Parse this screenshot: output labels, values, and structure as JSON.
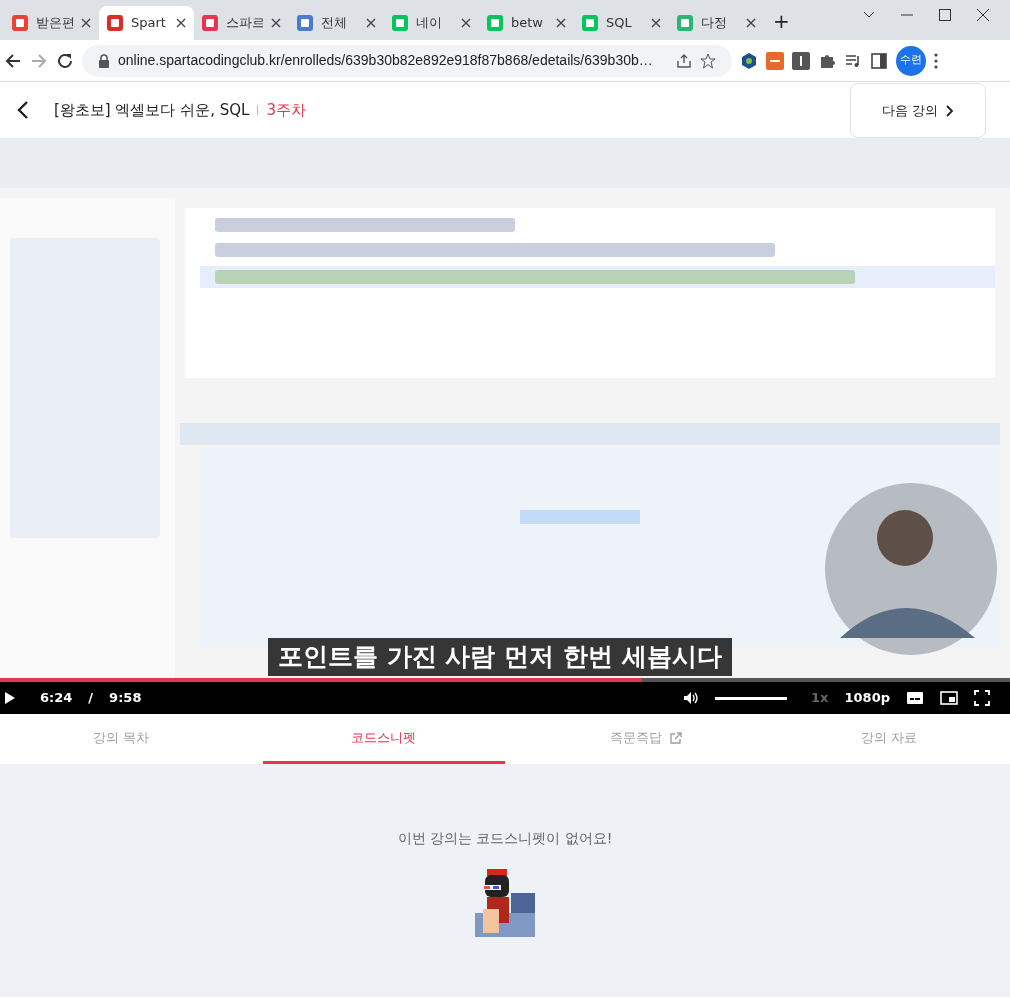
{
  "browser": {
    "tabs": [
      {
        "label": "받은편",
        "selected": false
      },
      {
        "label": "Spart",
        "selected": true
      },
      {
        "label": "스파르",
        "selected": false
      },
      {
        "label": "전체",
        "selected": false
      },
      {
        "label": "네이",
        "selected": false
      },
      {
        "label": "betw",
        "selected": false
      },
      {
        "label": "SQL",
        "selected": false
      },
      {
        "label": "다정",
        "selected": false
      }
    ],
    "new_tab": "+",
    "url": "online.spartacodingclub.kr/enrolleds/639b30b82e892e918f87b868/edetails/639b30b…",
    "profile": "수련"
  },
  "header": {
    "title": "[왕초보] 엑셀보다 쉬운, SQL",
    "week": "3주차",
    "next_button": "다음 강의"
  },
  "player": {
    "subtitle": "포인트를 가진 사람 먼저 한번 세봅시다",
    "progress": {
      "level": 0.636
    },
    "current_time": "6:24",
    "separator": "/",
    "duration": "9:58",
    "volume": {
      "level": 1
    },
    "speed": "1x",
    "quality": "1080p"
  },
  "lesson_tabs": [
    {
      "label": "강의 목차",
      "selected": false,
      "external": false
    },
    {
      "label": "코드스니펫",
      "selected": true,
      "external": false
    },
    {
      "label": "즉문즉답",
      "selected": false,
      "external": true
    },
    {
      "label": "강의 자료",
      "selected": false,
      "external": false
    }
  ],
  "empty_message": "이번 강의는 코드스니펫이 없어요!"
}
